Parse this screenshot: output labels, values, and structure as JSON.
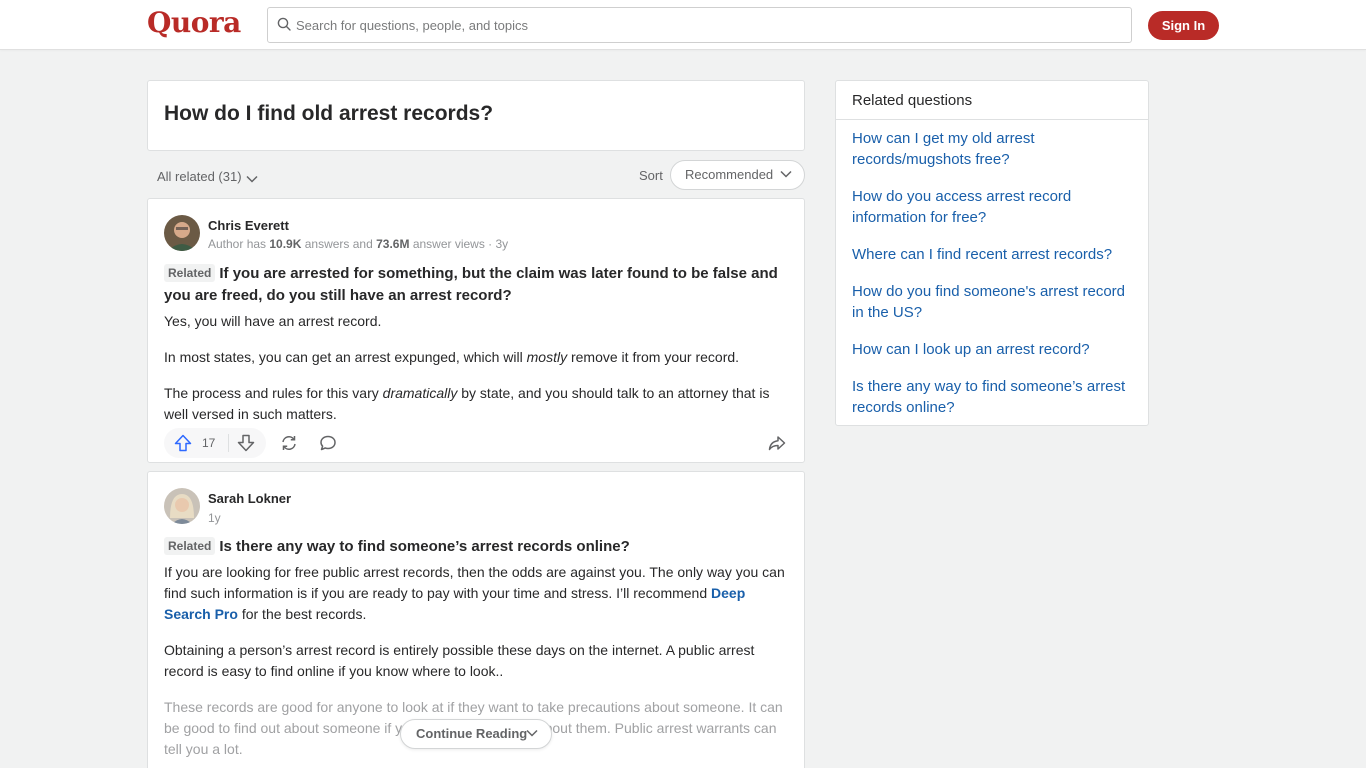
{
  "header": {
    "logo": "Quora",
    "search_placeholder": "Search for questions, people, and topics",
    "signin_label": "Sign In"
  },
  "question": {
    "title": "How do I find old arrest records?"
  },
  "filters": {
    "all_related": "All related (31)",
    "sort_label": "Sort",
    "sort_value": "Recommended"
  },
  "answers": [
    {
      "author": "Chris Everett",
      "meta_prefix": "Author has ",
      "meta_answers": "10.9K",
      "meta_mid": " answers and ",
      "meta_views": "73.6M",
      "meta_suffix": " answer views · 3y",
      "related_tag": "Related",
      "related_question": "If you are arrested for something, but the claim was later found to be false and you are freed, do you still have an arrest record?",
      "p1": "Yes, you will have an arrest record.",
      "p2_a": "In most states, you can get an arrest expunged, which will ",
      "p2_em": "mostly",
      "p2_b": " remove it from your record.",
      "p3_a": "The process and rules for this vary ",
      "p3_em": "dramatically",
      "p3_b": " by state, and you should talk to an attorney that is well versed in such matters.",
      "upvotes": "17"
    },
    {
      "author": "Sarah Lokner",
      "meta": "1y",
      "related_tag": "Related",
      "related_question": "Is there any way to find someone’s arrest records online?",
      "p1_a": "If you are looking for free public arrest records, then the odds are against you. The only way you can find such information is if you are ready to pay with your time and stress. I’ll recommend ",
      "p1_link": "Deep Search Pro",
      "p1_b": " for the best records.",
      "p2": "Obtaining a person’s arrest record is entirely possible these days on the internet. A public arrest record is easy to find online if you know where to look..",
      "p3": "These records are good for anyone to look at if they want to take precautions about someone. It can be good to find out about someone if you are having doubts about them. Public arrest warrants can tell you a lot.",
      "continue_label": "Continue Reading"
    }
  ],
  "sidebar": {
    "title": "Related questions",
    "links": [
      "How can I get my old arrest records/mugshots free?",
      "How do you access arrest record information for free?",
      "Where can I find recent arrest records?",
      "How do you find someone's arrest record in the US?",
      "How can I look up an arrest record?",
      "Is there any way to find someone’s arrest records online?"
    ]
  },
  "colors": {
    "brand": "#b92b27",
    "link": "#195faa",
    "upvote": "#2e69ff"
  }
}
